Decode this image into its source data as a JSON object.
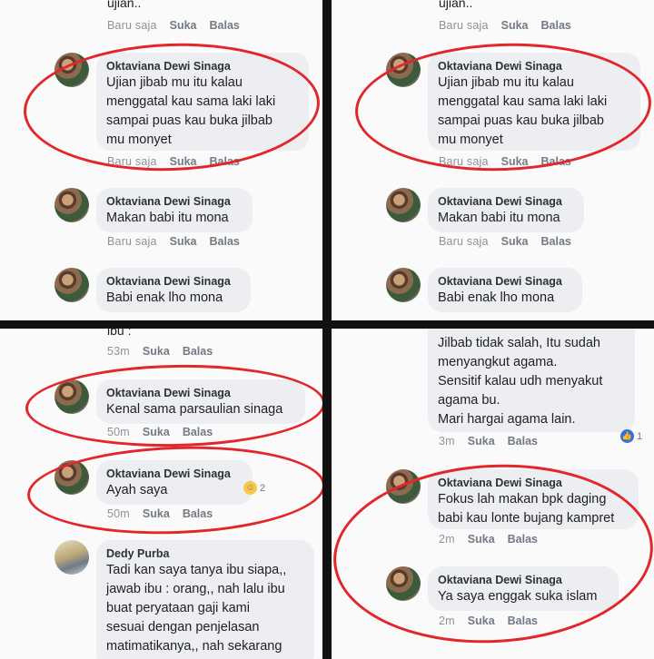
{
  "panels": [
    {
      "top_partial": "ujian..",
      "top_meta": {
        "time": "Baru saja",
        "like": "Suka",
        "reply": "Balas"
      },
      "comments": [
        {
          "name": "Oktaviana Dewi Sinaga",
          "text": "Ujian jibab mu itu kalau\nmenggatal kau sama laki laki\nsampai puas kau buka jilbab\nmu monyet",
          "time": "Baru saja",
          "like": "Suka",
          "reply": "Balas"
        },
        {
          "name": "Oktaviana Dewi Sinaga",
          "text": "Makan babi itu mona",
          "time": "Baru saja",
          "like": "Suka",
          "reply": "Balas"
        },
        {
          "name": "Oktaviana Dewi Sinaga",
          "text": "Babi enak lho mona",
          "time": "",
          "like": "",
          "reply": ""
        }
      ]
    },
    {
      "top_partial": "ujian..",
      "top_meta": {
        "time": "Baru saja",
        "like": "Suka",
        "reply": "Balas"
      },
      "comments": [
        {
          "name": "Oktaviana Dewi Sinaga",
          "text": "Ujian jibab mu itu kalau\nmenggatal kau sama laki laki\nsampai puas kau buka jilbab\nmu monyet",
          "time": "Baru saja",
          "like": "Suka",
          "reply": "Balas"
        },
        {
          "name": "Oktaviana Dewi Sinaga",
          "text": "Makan babi itu mona",
          "time": "Baru saja",
          "like": "Suka",
          "reply": "Balas"
        },
        {
          "name": "Oktaviana Dewi Sinaga",
          "text": "Babi enak lho mona",
          "time": "",
          "like": "",
          "reply": ""
        }
      ]
    },
    {
      "top_partial": "ibu :",
      "top_meta": {
        "time": "53m",
        "like": "Suka",
        "reply": "Balas"
      },
      "comments": [
        {
          "name": "Oktaviana Dewi Sinaga",
          "text": "Kenal sama parsaulian sinaga",
          "time": "50m",
          "like": "Suka",
          "reply": "Balas"
        },
        {
          "name": "Oktaviana Dewi Sinaga",
          "text": "Ayah saya",
          "time": "50m",
          "like": "Suka",
          "reply": "Balas",
          "reaction_count": "2"
        },
        {
          "name": "Dedy Purba",
          "text": "Tadi kan saya tanya ibu siapa,,\njawab ibu : orang,, nah lalu ibu\nbuat peryataan gaji kami\nsesuai dengan penjelasan\nmatimatikanya,, nah sekarang",
          "time": "",
          "like": "",
          "reply": ""
        }
      ]
    },
    {
      "top_partial": "Jilbab tidak salah, Itu sudah\nmenyangkut agama.\nSensitif kalau udh menyakut\nagama bu.\nMari hargai agama lain.",
      "top_meta": {
        "time": "3m",
        "like": "Suka",
        "reply": "Balas"
      },
      "top_reaction_count": "1",
      "comments": [
        {
          "name": "Oktaviana Dewi Sinaga",
          "text": "Fokus lah makan bpk daging\nbabi kau lonte bujang kampret",
          "time": "2m",
          "like": "Suka",
          "reply": "Balas"
        },
        {
          "name": "Oktaviana Dewi Sinaga",
          "text": "Ya saya enggak suka islam",
          "time": "2m",
          "like": "Suka",
          "reply": "Balas"
        }
      ]
    }
  ],
  "colors": {
    "annotation_ring": "#e2262a",
    "bubble": "#eceef2",
    "page": "#fafafa",
    "divider": "#111111"
  }
}
